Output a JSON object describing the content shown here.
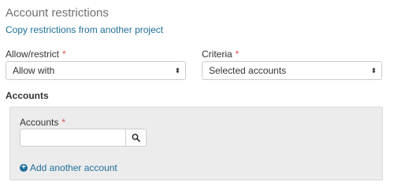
{
  "section": {
    "title": "Account restrictions",
    "copy_link": "Copy restrictions from another project"
  },
  "allow_restrict": {
    "label": "Allow/restrict",
    "required_mark": "*",
    "value": "Allow with",
    "arrows": "⬍"
  },
  "criteria": {
    "label": "Criteria",
    "required_mark": "*",
    "value": "Selected accounts",
    "arrows": "⬍"
  },
  "accounts": {
    "heading": "Accounts",
    "field_label": "Accounts",
    "required_mark": "*",
    "input_value": "",
    "add_plus": "+",
    "add_link": "Add another account"
  },
  "colors": {
    "link": "#1e6f9a",
    "required": "#d9534f",
    "panel_bg": "#ececec"
  }
}
